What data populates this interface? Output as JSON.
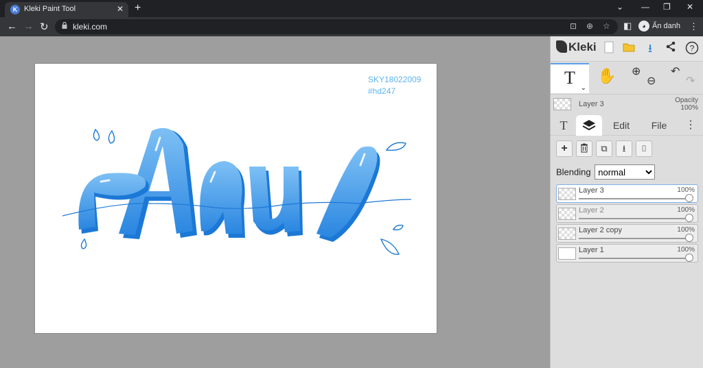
{
  "browser": {
    "tab_title": "Kleki Paint Tool",
    "url": "kleki.com",
    "profile_label": "Ẩn danh"
  },
  "canvas": {
    "watermark_line1": "SKY18022009",
    "watermark_line2": "#hd247",
    "artwork_text": "Aaul",
    "colors": {
      "letter_fill": "#7ec0f5",
      "letter_shade": "#2a86e0",
      "outline": "#1c78d6"
    }
  },
  "panel": {
    "logo": "Kleki",
    "current_layer": "Layer 3",
    "opacity_label": "Opacity",
    "opacity_value": "100%",
    "tabs": [
      "Edit",
      "File"
    ],
    "blending_label": "Blending",
    "blending_value": "normal",
    "blending_options": [
      "normal"
    ],
    "layers": [
      {
        "name": "Layer 3",
        "opacity": "100%",
        "opacity_level": 1.0
      },
      {
        "name": "Layer 2",
        "opacity": "100%",
        "opacity_level": 1.0
      },
      {
        "name": "Layer 2 copy",
        "opacity": "100%",
        "opacity_level": 1.0
      },
      {
        "name": "Layer 1",
        "opacity": "100%",
        "opacity_level": 1.0
      }
    ]
  },
  "icons": {
    "tab_favicon": "kleki-icon",
    "text_tool": "text-tool-icon",
    "hand_tool": "hand-icon",
    "zoom_in": "zoom-in-icon",
    "zoom_out": "zoom-out-icon",
    "undo": "undo-icon",
    "redo": "redo-icon",
    "new": "new-image-icon",
    "open": "folder-icon",
    "download": "download-icon",
    "share": "share-icon",
    "help": "help-icon",
    "layers": "layers-icon",
    "add_layer": "plus-icon",
    "delete_layer": "trash-icon",
    "duplicate_layer": "duplicate-icon",
    "merge_layer": "merge-icon",
    "rename_layer": "rename-icon"
  }
}
